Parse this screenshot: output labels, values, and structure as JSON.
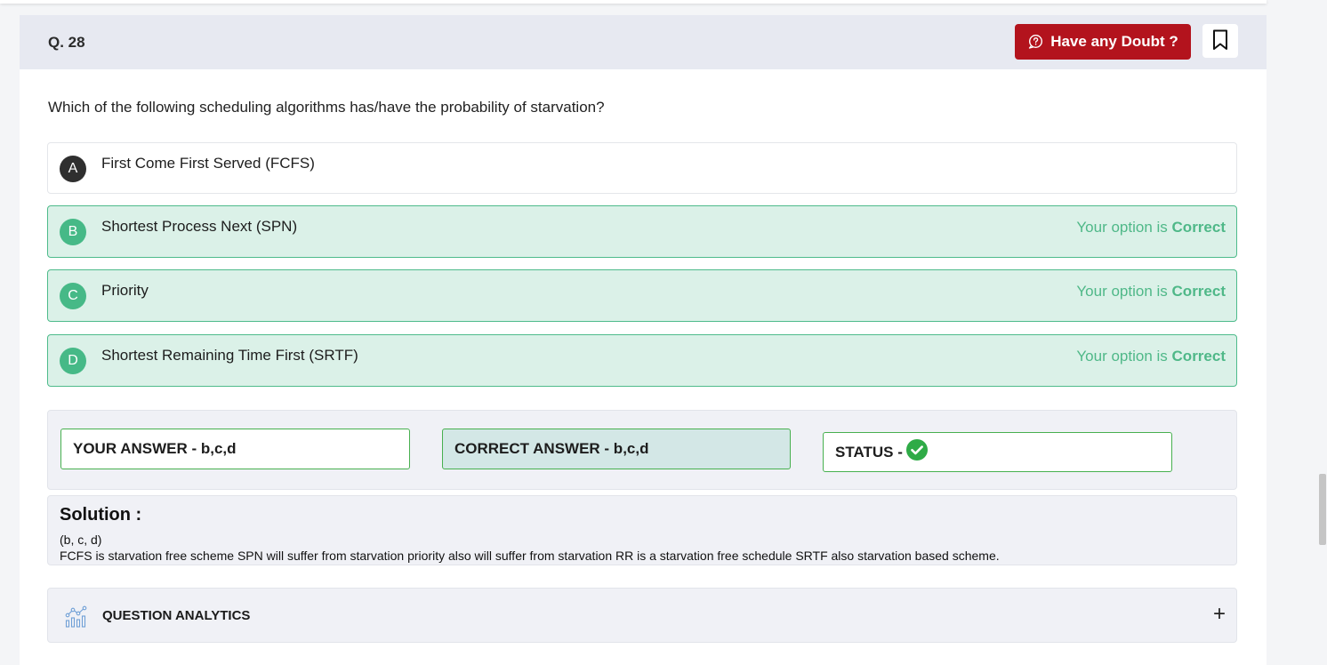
{
  "header": {
    "question_number": "Q. 28",
    "doubt_button_label": "Have any Doubt ?",
    "doubt_color": "#b3131d"
  },
  "question": {
    "text": "Which of the following scheduling algorithms has/have the probability of starvation?"
  },
  "options": [
    {
      "letter": "A",
      "text": "First Come First Served (FCFS)",
      "selected": false
    },
    {
      "letter": "B",
      "text": "Shortest Process Next (SPN)",
      "selected": true,
      "status_prefix": "Your option is ",
      "status_word": "Correct"
    },
    {
      "letter": "C",
      "text": "Priority",
      "selected": true,
      "status_prefix": "Your option is ",
      "status_word": "Correct"
    },
    {
      "letter": "D",
      "text": "Shortest Remaining Time First (SRTF)",
      "selected": true,
      "status_prefix": "Your option is ",
      "status_word": "Correct"
    }
  ],
  "answers": {
    "your_answer": "YOUR ANSWER - b,c,d",
    "correct_answer": "CORRECT ANSWER - b,c,d",
    "status_label": "STATUS -",
    "status_icon": "check-circle-icon",
    "status_color": "#2fab47"
  },
  "solution": {
    "title": "Solution :",
    "line1": "(b, c, d)",
    "line2": "FCFS is starvation free scheme SPN will suffer from starvation priority also will suffer from starvation RR is a starvation free schedule SRTF also starvation based scheme."
  },
  "analytics": {
    "label": "QUESTION ANALYTICS",
    "icon": "analytics-chart-icon",
    "expand_icon": "plus-icon",
    "expand_glyph": "+"
  },
  "colors": {
    "correct_green": "#4fb888",
    "correct_bg": "#dbf1e8"
  }
}
